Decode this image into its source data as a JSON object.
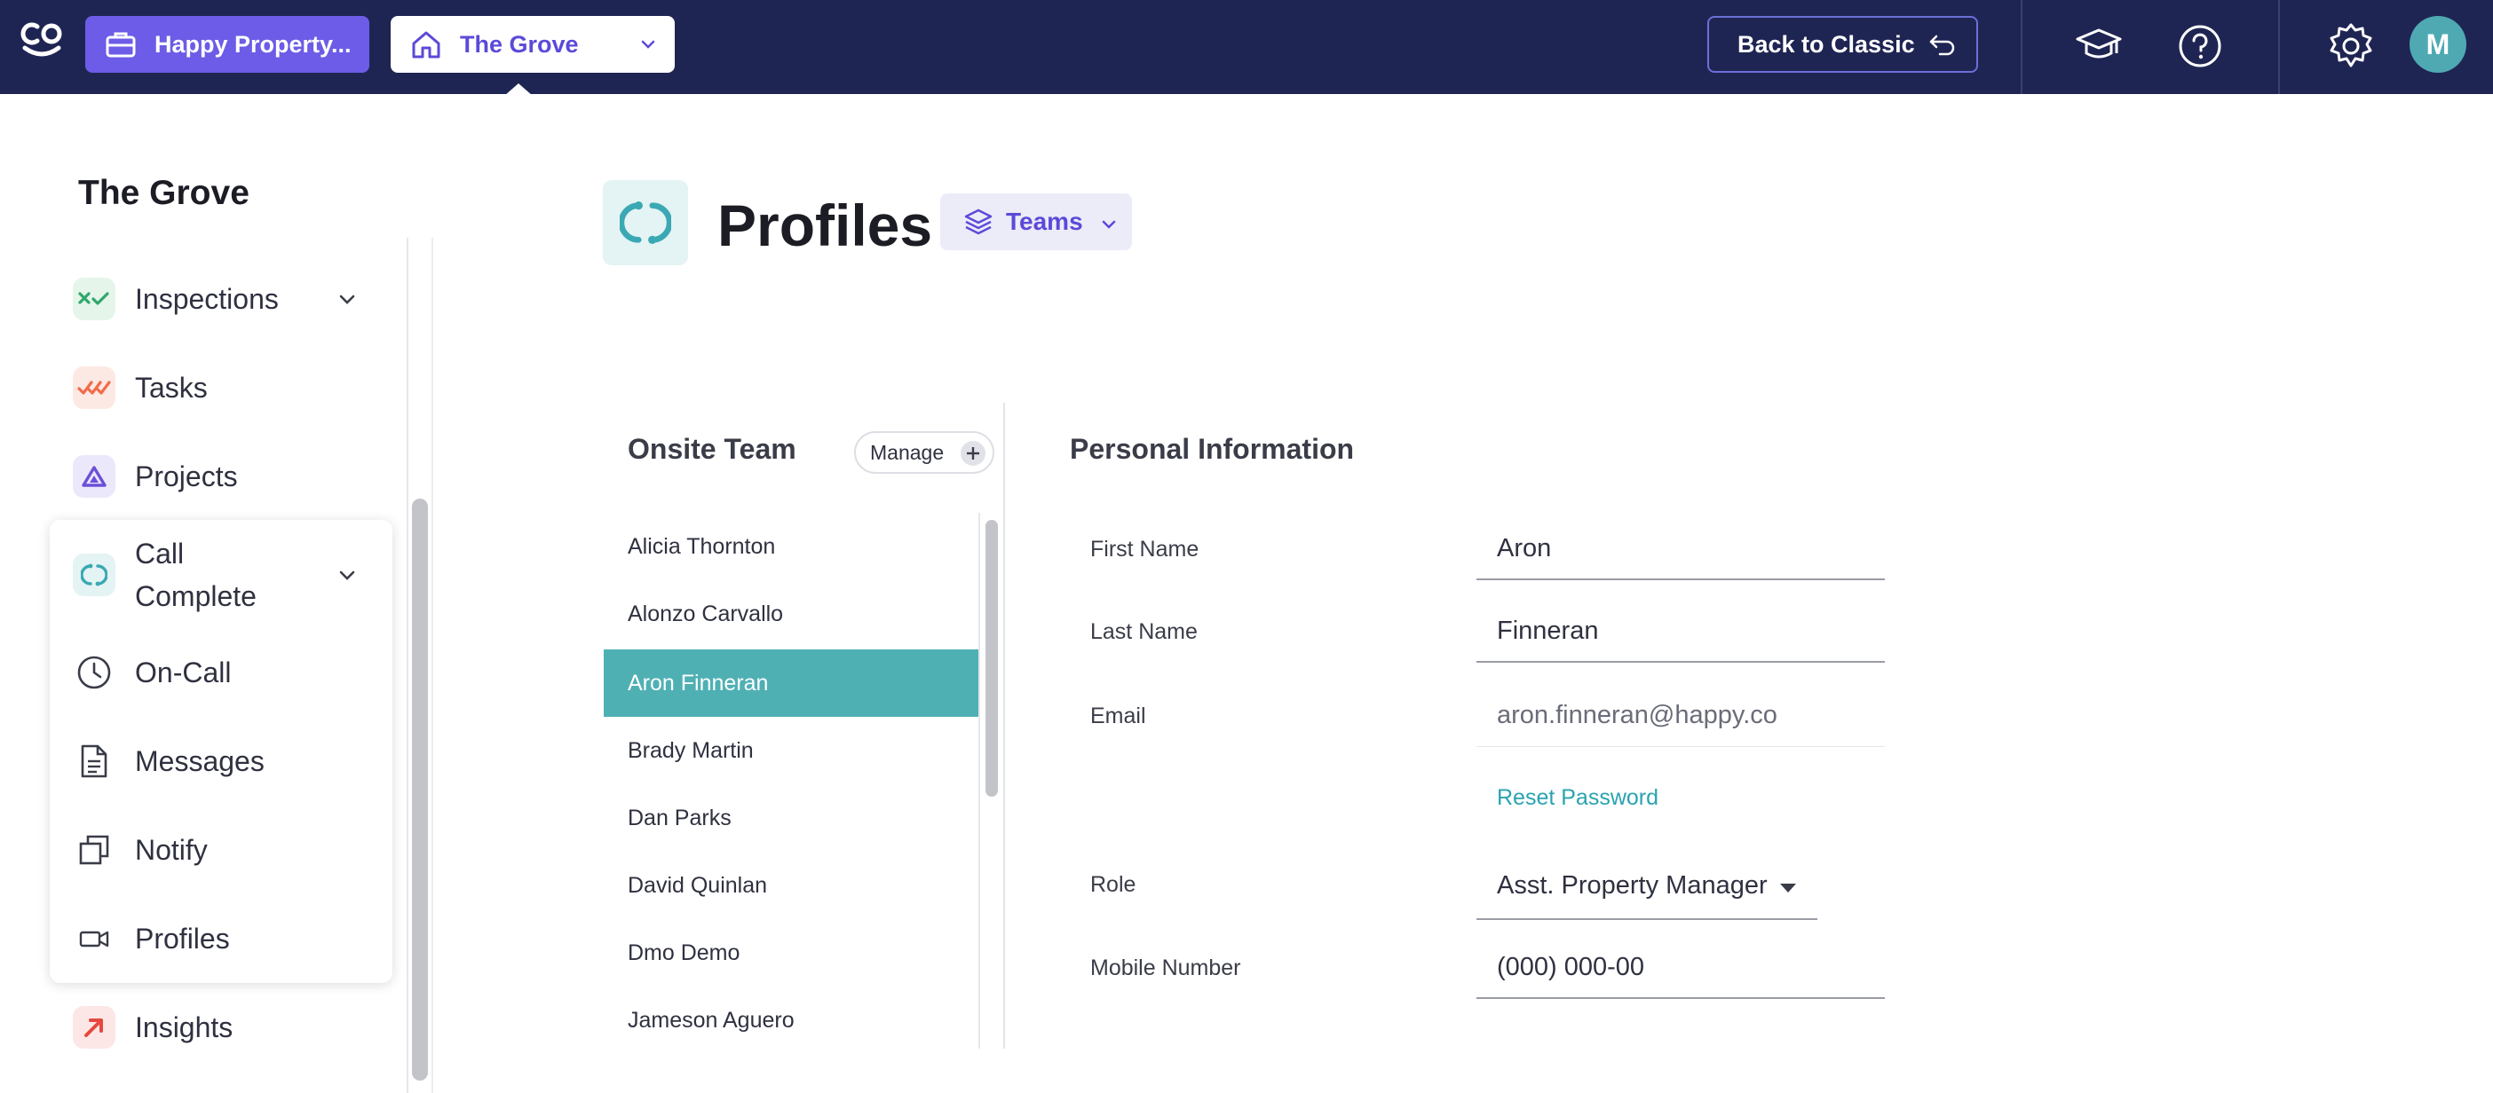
{
  "topbar": {
    "logo_icon": "happyco-logo-icon",
    "org_label": "Happy Property...",
    "org_icon": "briefcase-icon",
    "property_label": "The Grove",
    "property_icon": "home-icon",
    "back_label": "Back to Classic",
    "back_icon": "undo-arrow-icon",
    "help_icons": [
      "graduation-cap-icon",
      "help-circle-icon",
      "gear-icon"
    ],
    "avatar_initial": "M",
    "colors": {
      "bar": "#1f2553",
      "org_button": "#6c5ce7",
      "avatar": "#4fa9b3"
    }
  },
  "sidebar": {
    "title": "The Grove",
    "items": [
      {
        "label": "Inspections",
        "icon": "inspections-icon",
        "expandable": true
      },
      {
        "label": "Tasks",
        "icon": "tasks-icon",
        "expandable": false
      },
      {
        "label": "Projects",
        "icon": "projects-icon",
        "expandable": false
      },
      {
        "label": "Call Complete",
        "icon": "call-complete-icon",
        "expandable": true,
        "expanded": true
      },
      {
        "label": "On-Call",
        "icon": "clock-icon",
        "expandable": false
      },
      {
        "label": "Messages",
        "icon": "document-icon",
        "expandable": false
      },
      {
        "label": "Notify",
        "icon": "copy-icon",
        "expandable": false
      },
      {
        "label": "Profiles",
        "icon": "video-icon",
        "expandable": false
      },
      {
        "label": "Insights",
        "icon": "insights-icon",
        "expandable": false
      }
    ]
  },
  "page": {
    "title": "Profiles",
    "icon": "call-complete-icon",
    "teams_label": "Teams",
    "teams_icon": "layers-icon"
  },
  "team": {
    "heading": "Onsite Team",
    "manage_label": "Manage",
    "members": [
      "Alicia Thornton",
      "Alonzo Carvallo",
      "Aron Finneran",
      "Brady Martin",
      "Dan Parks",
      "David Quinlan",
      "Dmo Demo",
      "Jameson Aguero"
    ],
    "selected_member": "Aron Finneran"
  },
  "personal_info": {
    "heading": "Personal Information",
    "first_name_label": "First Name",
    "first_name": "Aron",
    "last_name_label": "Last Name",
    "last_name": "Finneran",
    "email_label": "Email",
    "email": "aron.finneran@happy.co",
    "reset_password": "Reset Password",
    "role_label": "Role",
    "role": "Asst. Property Manager",
    "mobile_label": "Mobile Number",
    "mobile": "(000) 000-00"
  }
}
